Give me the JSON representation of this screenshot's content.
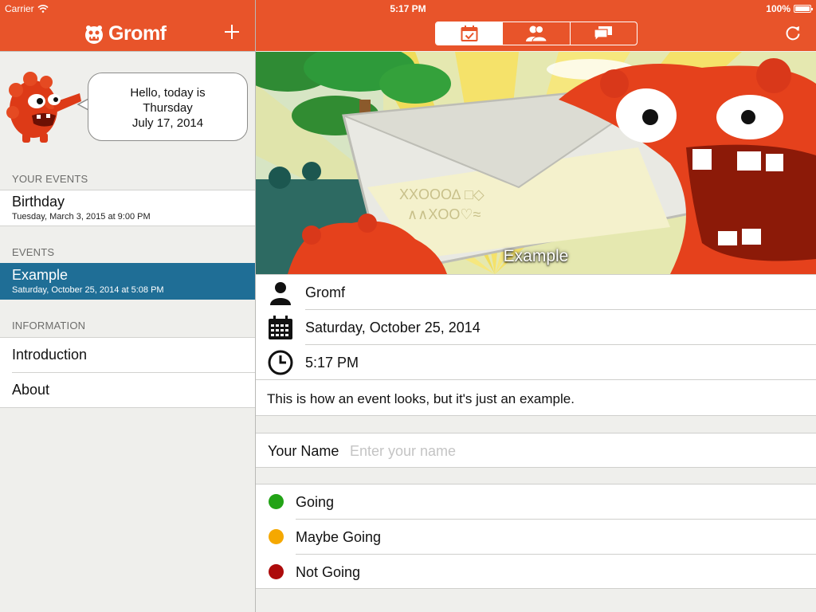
{
  "status_bar": {
    "carrier": "Carrier",
    "time": "5:17 PM",
    "battery": "100%"
  },
  "app": {
    "title": "Gromf"
  },
  "toolbar": {
    "segments": [
      {
        "icon": "calendar-check-icon",
        "selected": true
      },
      {
        "icon": "people-icon",
        "selected": false
      },
      {
        "icon": "chat-bubbles-icon",
        "selected": false
      }
    ],
    "accent_color": "#e8542a"
  },
  "greeting": {
    "line1": "Hello, today is",
    "line2": "Thursday",
    "line3": "July 17, 2014"
  },
  "sidebar": {
    "your_events_header": "YOUR EVENTS",
    "your_events": [
      {
        "title": "Birthday",
        "subtitle": "Tuesday, March 3, 2015 at 9:00 PM"
      }
    ],
    "events_header": "EVENTS",
    "events": [
      {
        "title": "Example",
        "subtitle": "Saturday, October 25, 2014 at 5:08 PM",
        "selected": true
      }
    ],
    "information_header": "INFORMATION",
    "information": [
      {
        "title": "Introduction"
      },
      {
        "title": "About"
      }
    ],
    "selected_color": "#1f6e96"
  },
  "event": {
    "hero_title": "Example",
    "organizer": "Gromf",
    "date": "Saturday, October 25, 2014",
    "time": "5:17 PM",
    "description": "This is how an event looks, but it's just an example."
  },
  "name_field": {
    "label": "Your Name",
    "value": "",
    "placeholder": "Enter your name"
  },
  "rsvp": {
    "options": [
      {
        "label": "Going",
        "color": "#22a316"
      },
      {
        "label": "Maybe Going",
        "color": "#f5a800"
      },
      {
        "label": "Not Going",
        "color": "#ad0b0b"
      }
    ]
  }
}
